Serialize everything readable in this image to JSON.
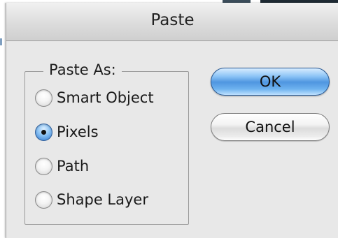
{
  "dialog": {
    "title": "Paste"
  },
  "paste_as": {
    "legend": "Paste As:",
    "options": [
      {
        "label": "Smart Object",
        "checked": false
      },
      {
        "label": "Pixels",
        "checked": true
      },
      {
        "label": "Path",
        "checked": false
      },
      {
        "label": "Shape Layer",
        "checked": false
      }
    ]
  },
  "buttons": {
    "ok_label": "OK",
    "cancel_label": "Cancel"
  },
  "colors": {
    "default_button": "#6eb2ef",
    "selected_radio": "#2f79d0",
    "dialog_background": "#e8e8e8"
  }
}
